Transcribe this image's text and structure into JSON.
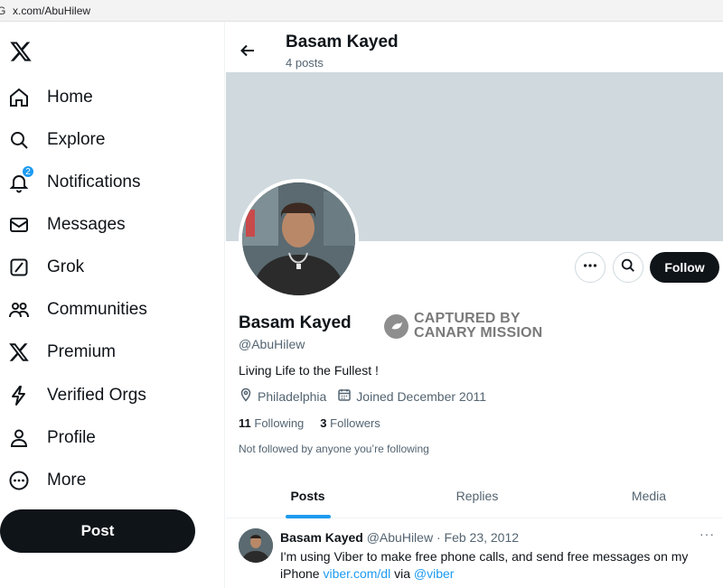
{
  "browser": {
    "url": "x.com/AbuHilew",
    "left_glyph": "G"
  },
  "sidebar": {
    "items": [
      {
        "label": "Home",
        "icon": "home-icon"
      },
      {
        "label": "Explore",
        "icon": "search-icon"
      },
      {
        "label": "Notifications",
        "icon": "bell-icon",
        "badge": "2"
      },
      {
        "label": "Messages",
        "icon": "envelope-icon"
      },
      {
        "label": "Grok",
        "icon": "grok-icon"
      },
      {
        "label": "Communities",
        "icon": "people-icon"
      },
      {
        "label": "Premium",
        "icon": "x-logo-icon"
      },
      {
        "label": "Verified Orgs",
        "icon": "lightning-icon"
      },
      {
        "label": "Profile",
        "icon": "person-icon"
      },
      {
        "label": "More",
        "icon": "more-circle-icon"
      }
    ],
    "post_label": "Post"
  },
  "header": {
    "name": "Basam Kayed",
    "posts_count": "4 posts"
  },
  "profile": {
    "name": "Basam Kayed",
    "handle": "@AbuHilew",
    "bio": "Living Life to the Fullest !",
    "location": "Philadelphia",
    "joined": "Joined December 2011",
    "following_count": "11",
    "following_label": "Following",
    "followers_count": "3",
    "followers_label": "Followers",
    "not_followed": "Not followed by anyone you’re following",
    "follow_label": "Follow"
  },
  "watermark": {
    "line1": "CAPTURED BY",
    "line2": "CANARY MISSION"
  },
  "tabs": [
    {
      "label": "Posts",
      "active": true
    },
    {
      "label": "Replies",
      "active": false
    },
    {
      "label": "Media",
      "active": false
    }
  ],
  "tweet": {
    "name": "Basam Kayed",
    "handle": "@AbuHilew",
    "sep": " · ",
    "date": "Feb 23, 2012",
    "more": "···",
    "text_1": "I'm using Viber to make free phone calls, and send free messages on my iPhone ",
    "link_1": "viber.com/dl",
    "text_2": " via ",
    "link_2": "@viber"
  },
  "colors": {
    "accent": "#1d9bf0",
    "banner": "#cfd9de",
    "text": "#0f1419",
    "muted": "#536471"
  }
}
